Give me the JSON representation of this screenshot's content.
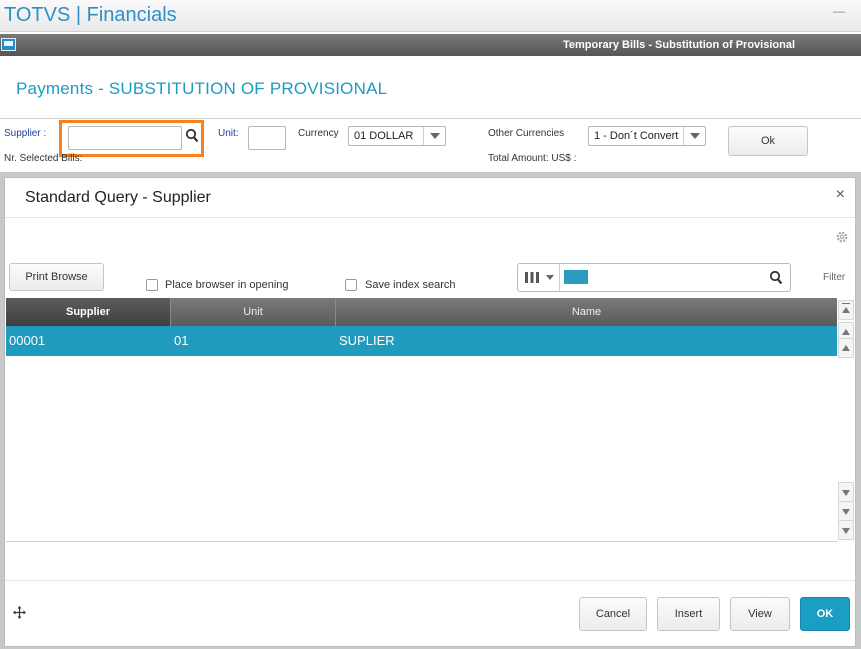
{
  "app": {
    "title": "TOTVS | Financials"
  },
  "routine": {
    "title": "Temporary Bills - Substitution of Provisional"
  },
  "page": {
    "title": "Payments - SUBSTITUTION OF PROVISIONAL"
  },
  "form": {
    "supplier_label": "Supplier :",
    "supplier_value": "",
    "unit_label": "Unit:",
    "unit_value": "",
    "currency_label": "Currency",
    "currency_value": "01 DOLLAR",
    "other_currencies_label": "Other Currencies",
    "other_currencies_value": "1 - Don´t Convert",
    "ok_label": "Ok",
    "nr_selected_label": "Nr. Selected Bills:",
    "total_amount_label": "Total Amount: US$ :"
  },
  "dialog": {
    "title": "Standard Query - Supplier",
    "close_glyph": "×",
    "print_browse_label": "Print Browse",
    "place_browser_label": "Place browser in opening",
    "save_index_label": "Save index search",
    "filter_label": "Filter",
    "search_value": "",
    "columns": [
      "Supplier",
      "Unit",
      "Name"
    ],
    "rows": [
      {
        "supplier": "00001",
        "unit": "01",
        "name": "SUPLIER"
      }
    ],
    "buttons": {
      "cancel": "Cancel",
      "insert": "Insert",
      "view": "View",
      "ok": "OK"
    }
  },
  "colors": {
    "accent": "#1b9ec3",
    "highlight": "#f58220",
    "title_blue": "#2f8fc5"
  },
  "icons": [
    "app-window-icon",
    "search-icon",
    "chevron-down-icon",
    "gear-icon",
    "columns-icon",
    "close-icon",
    "move-icon",
    "scroll-up-icon",
    "scroll-down-icon"
  ]
}
